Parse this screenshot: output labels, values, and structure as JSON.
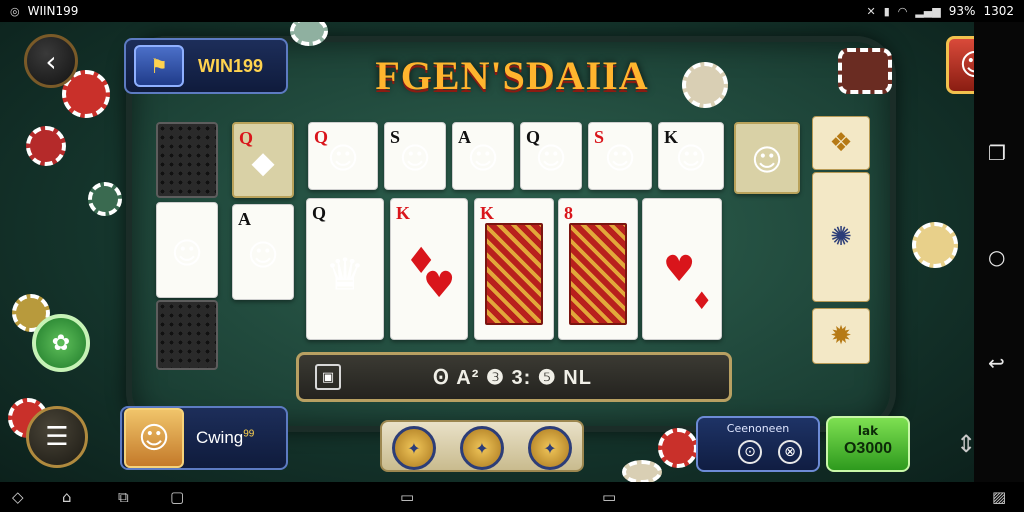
{
  "status_bar": {
    "app_name": "WIIN199",
    "time": "1302",
    "battery": "93%"
  },
  "game": {
    "title": "FGEN'SDAIIA",
    "brand_name": "WIN199",
    "opponent_name": "Cwing",
    "opponent_badge": "99",
    "action_text": "Ꙩ A² ❸ 3: ❺ NL",
    "bet_label": "Ceenoneen",
    "go_label": "lak",
    "go_value": "O3000",
    "top_row_ranks": [
      "Q",
      "S",
      "A",
      "Q",
      "S",
      "K"
    ],
    "big_cards": [
      {
        "rank": "Q",
        "suit": "♣"
      },
      {
        "rank": "K",
        "suit": "♦"
      },
      {
        "rank": "K",
        "suit": "♦"
      },
      {
        "rank": "8",
        "suit": "♦"
      },
      {
        "rank": "",
        "suit": "♥"
      }
    ],
    "left_cards": [
      {
        "rank": "Q",
        "suit": "♥"
      },
      {
        "rank": "A",
        "suit": "♠"
      }
    ]
  },
  "icons": {
    "back": "chevron-left-icon",
    "menu": "hamburger-icon",
    "square": "recent-apps-icon",
    "circle": "home-icon",
    "return": "back-arrow-icon"
  },
  "colors": {
    "felt": "#214a3d",
    "gold": "#ffd34f",
    "title_orange": "#ffb52e",
    "go_green": "#2e9a1e"
  }
}
